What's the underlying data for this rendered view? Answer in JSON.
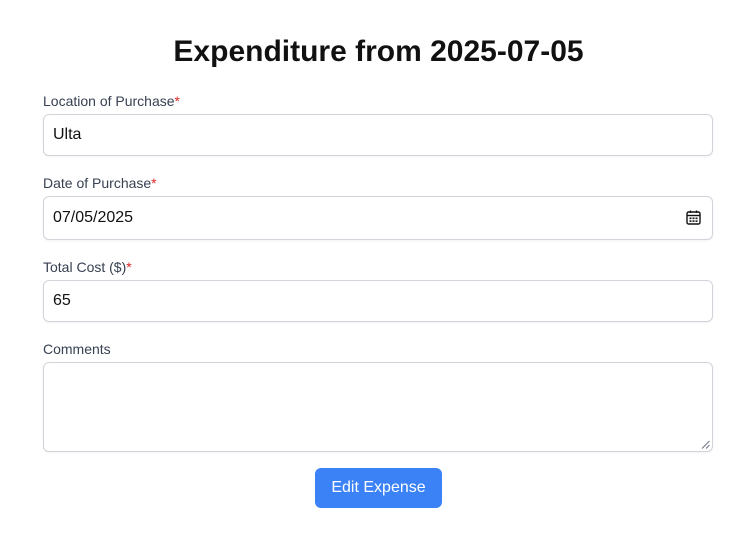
{
  "page": {
    "title": "Expenditure from 2025-07-05"
  },
  "form": {
    "location": {
      "label": "Location of Purchase",
      "required_mark": "*",
      "value": "Ulta"
    },
    "date": {
      "label": "Date of Purchase",
      "required_mark": "*",
      "value": "07/05/2025",
      "icon": "calendar-icon"
    },
    "total_cost": {
      "label": "Total Cost ($)",
      "required_mark": "*",
      "value": "65"
    },
    "comments": {
      "label": "Comments",
      "value": ""
    },
    "submit_label": "Edit Expense"
  },
  "colors": {
    "accent": "#3b82f6",
    "required": "#dc2626",
    "border": "#d1d5db",
    "label": "#374151"
  }
}
